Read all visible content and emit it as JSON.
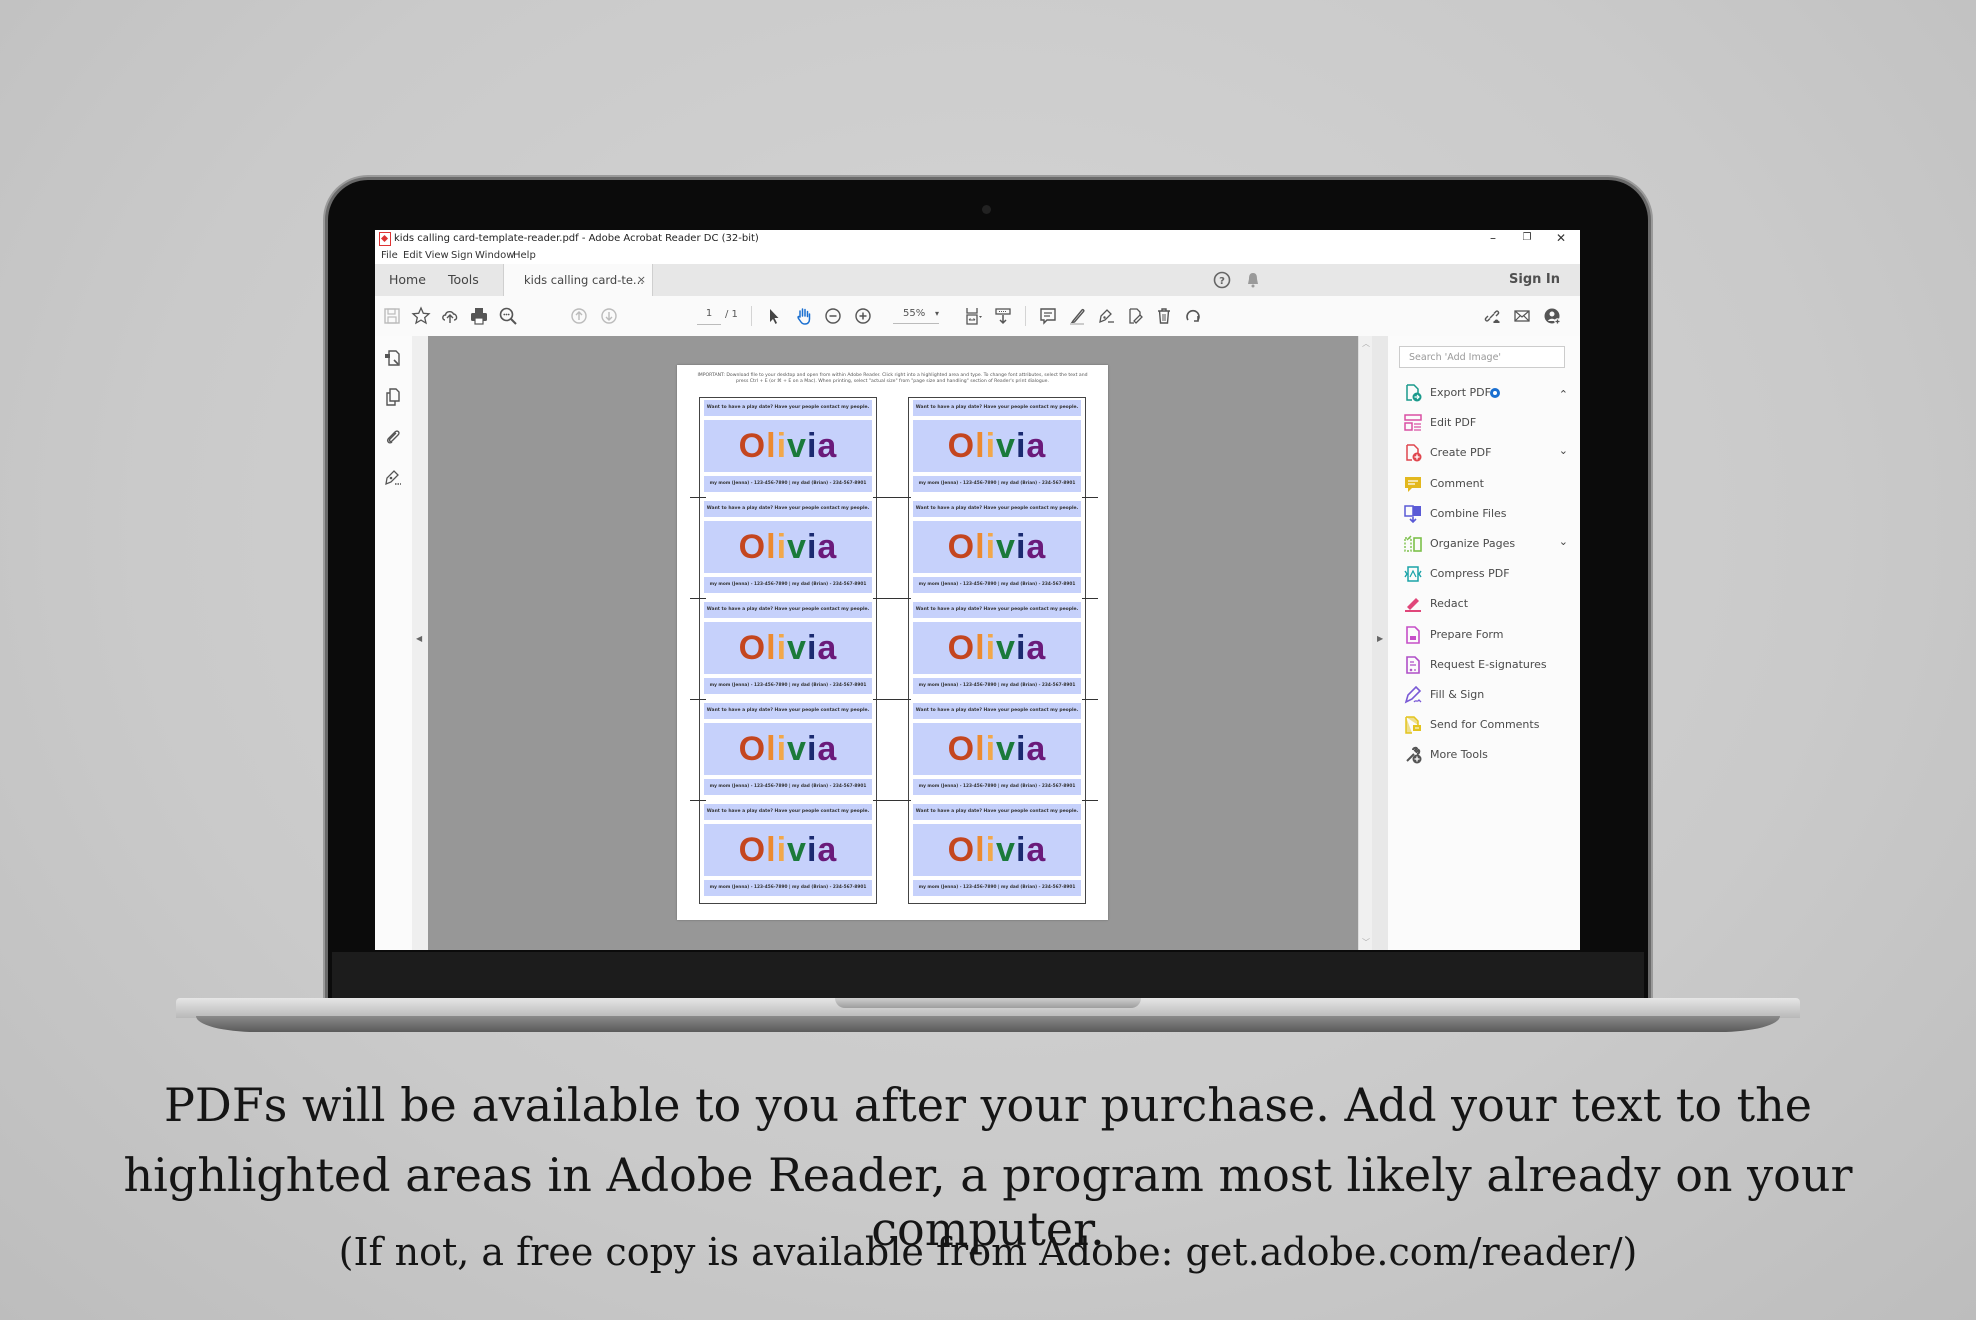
{
  "window": {
    "title": "kids calling card-template-reader.pdf - Adobe Acrobat Reader DC (32-bit)",
    "controls": {
      "minimize": "–",
      "restore": "❐",
      "close": "✕"
    }
  },
  "menu": [
    "File",
    "Edit",
    "View",
    "Sign",
    "Window",
    "Help"
  ],
  "tabs": {
    "home": "Home",
    "tools": "Tools",
    "document": "kids calling card-te...",
    "close": "×"
  },
  "header_right": {
    "sign_in": "Sign In"
  },
  "toolbar": {
    "page_current": "1",
    "page_total": "/ 1",
    "zoom": "55%",
    "zoom_dropdown": "▾",
    "icons": [
      "save-icon",
      "bookmark-star-icon",
      "upload-cloud-icon",
      "print-icon",
      "find-icon",
      "prev-page-icon",
      "next-page-icon",
      "select-arrow-icon",
      "hand-icon",
      "zoom-out-icon",
      "zoom-in-icon",
      "page-fit-icon",
      "scroll-mode-icon",
      "comment-icon",
      "highlight-icon",
      "sign-icon",
      "attach-icon",
      "delete-icon",
      "rotate-icon",
      "share-link-icon",
      "email-icon",
      "add-user-icon"
    ]
  },
  "left_rail": [
    "page-thumbnails-icon",
    "copy-pages-icon",
    "attachments-icon",
    "signatures-icon"
  ],
  "right_panel": {
    "search_placeholder": "Search 'Add Image'",
    "tools": [
      {
        "label": "Export PDF",
        "color": "#1a9a8c",
        "chevron": "⌃",
        "badge": true
      },
      {
        "label": "Edit PDF",
        "color": "#d94fa3"
      },
      {
        "label": "Create PDF",
        "color": "#e0464e",
        "chevron": "⌄"
      },
      {
        "label": "Comment",
        "color": "#e3b81e"
      },
      {
        "label": "Combine Files",
        "color": "#5a5ad6"
      },
      {
        "label": "Organize Pages",
        "color": "#7cc04a",
        "chevron": "⌄"
      },
      {
        "label": "Compress PDF",
        "color": "#1aa3a8"
      },
      {
        "label": "Redact",
        "color": "#e0467a"
      },
      {
        "label": "Prepare Form",
        "color": "#c64fc8"
      },
      {
        "label": "Request E-signatures",
        "color": "#b04fc8"
      },
      {
        "label": "Fill & Sign",
        "color": "#7a5ad6"
      },
      {
        "label": "Send for Comments",
        "color": "#e3c41e"
      },
      {
        "label": "More Tools",
        "color": "#555555"
      }
    ]
  },
  "pdf": {
    "important": "IMPORTANT: Download file to your desktop and open from within Adobe Reader. Click right into a highlighted area and type. To change font attributes, select the text and press Ctrl + E (or ⌘ + E on a Mac). When printing, select \"actual size\" from \"page size and handling\" section of Reader's print dialogue.",
    "card": {
      "top_line": "Want to have a play date?  Have your people contact my people.",
      "name_letters": [
        "O",
        "l",
        "i",
        "v",
        "i",
        "a"
      ],
      "name_colors": [
        "#c4461f",
        "#ec8a30",
        "#f2a84a",
        "#1a7a3a",
        "#1a2a70",
        "#6a1a7a"
      ],
      "bottom_line": "my mom (Jenna) - 123-456-7890 | my dad (Brian) - 234-567-8901",
      "field_color": "#c6d1fb"
    },
    "rows": 5,
    "columns": 2
  },
  "caption": {
    "line1": "PDFs will be available to you after your purchase.  Add your text to the",
    "line2": "highlighted areas in Adobe Reader, a program most likely already on your computer.",
    "line3": "(If not, a free copy is available from Adobe: get.adobe.com/reader/)"
  }
}
